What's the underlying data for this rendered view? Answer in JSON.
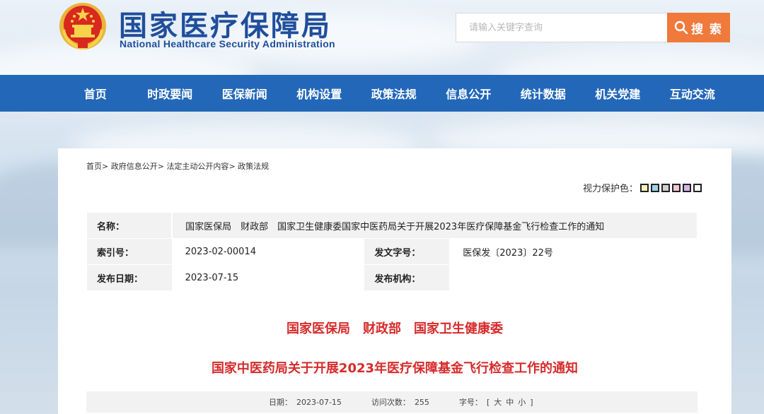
{
  "header": {
    "site_title_cn": "国家医疗保障局",
    "site_title_en": "National Healthcare Security Administration",
    "search_placeholder": "请输入关键字查询",
    "search_label": "搜 索"
  },
  "nav": {
    "items": [
      "首页",
      "时政要闻",
      "医保新闻",
      "机构设置",
      "政策法规",
      "信息公开",
      "统计数据",
      "机关党建",
      "互动交流"
    ]
  },
  "breadcrumb": {
    "items": [
      "首页",
      "政府信息公开",
      "法定主动公开内容",
      "政策法规"
    ],
    "separator": ">"
  },
  "eye_care": {
    "label": "视力保护色：",
    "colors": [
      "#f7f3b8",
      "#9ed3ee",
      "#d0d0d0",
      "#f4c7d6",
      "#d6b6ee",
      "#ffffff"
    ]
  },
  "info": {
    "name_label": "名称：",
    "name_value": "国家医保局　财政部　国家卫生健康委国家中医药局关于开展2023年医疗保障基金飞行检查工作的通知",
    "index_label": "索引号：",
    "index_value": "2023-02-00014",
    "docno_label": "发文字号：",
    "docno_value": "医保发〔2023〕22号",
    "date_label": "发布日期：",
    "date_value": "2023-07-15",
    "org_label": "发布机构：",
    "org_value": ""
  },
  "document": {
    "issuers": "国家医保局　财政部　国家卫生健康委",
    "title": "国家中医药局关于开展2023年医疗保障基金飞行检查工作的通知"
  },
  "meta": {
    "date_label": "日期：",
    "date_value": "2023-07-15",
    "visits_label": "访问次数：",
    "visits_value": "255",
    "fontsize_label": "字号：",
    "size_open": "[",
    "size_large": "大",
    "size_medium": "中",
    "size_small": "小",
    "size_close": "]"
  },
  "colors": {
    "brand_blue": "#1f4e9b",
    "nav_blue": "#2367b9",
    "search_orange": "#ef7a3c",
    "title_red": "#d62b2b"
  }
}
